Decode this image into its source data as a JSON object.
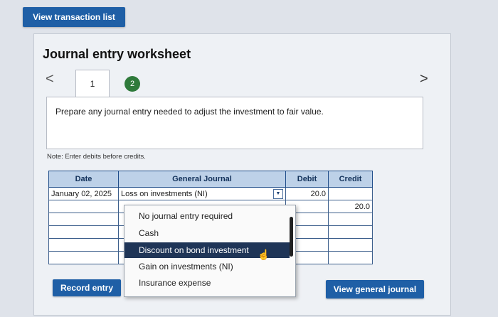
{
  "top_button": "View transaction list",
  "worksheet": {
    "title": "Journal entry worksheet",
    "tabs": [
      {
        "label": "1"
      },
      {
        "label": "2"
      }
    ],
    "prev_icon": "<",
    "next_icon": ">",
    "instruction": "Prepare any journal entry needed to adjust the investment to fair value.",
    "note": "Note: Enter debits before credits."
  },
  "table": {
    "headers": {
      "date": "Date",
      "journal": "General Journal",
      "debit": "Debit",
      "credit": "Credit"
    },
    "rows": [
      {
        "date": "January 02, 2025",
        "account": "Loss on investments (NI)",
        "debit": "20.0",
        "credit": ""
      },
      {
        "date": "",
        "account": "",
        "debit": "",
        "credit": "20.0"
      }
    ]
  },
  "dropdown": {
    "options": [
      "No journal entry required",
      "Cash",
      "Discount on bond investment",
      "Gain on investments (NI)",
      "Insurance expense"
    ],
    "selected": "Discount on bond investment"
  },
  "buttons": {
    "record": "Record entry",
    "view_general": "View general journal"
  }
}
